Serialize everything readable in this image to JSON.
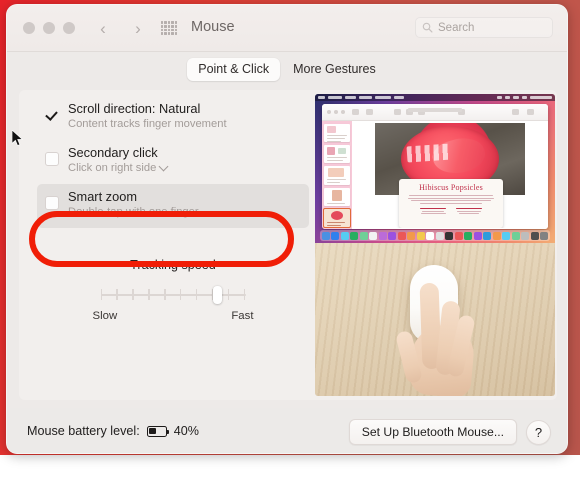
{
  "window": {
    "title": "Mouse",
    "traffic_lights": [
      "close-button",
      "minimize-button",
      "zoom-button"
    ],
    "nav_back": "‹",
    "nav_forward": "›",
    "grid_icon": "all-preferences-grid-icon"
  },
  "search": {
    "placeholder": "Search",
    "value": "",
    "icon": "search-icon"
  },
  "tabs": [
    {
      "label": "Point & Click",
      "selected": true
    },
    {
      "label": "More Gestures",
      "selected": false
    }
  ],
  "options": [
    {
      "title": "Scroll direction: Natural",
      "subtitle": "Content tracks finger movement",
      "checked": true,
      "has_dropdown": false,
      "highlighted": false
    },
    {
      "title": "Secondary click",
      "subtitle": "Click on right side",
      "checked": false,
      "has_dropdown": true,
      "highlighted": false
    },
    {
      "title": "Smart zoom",
      "subtitle": "Double-tap with one finger",
      "checked": false,
      "has_dropdown": false,
      "highlighted": true
    }
  ],
  "slider": {
    "label": "Tracking speed",
    "min_label": "Slow",
    "max_label": "Fast",
    "tick_count": 10,
    "value_percent": 81
  },
  "preview": {
    "desktop": {
      "document_title": "Hibiscus Popsicles"
    },
    "photo_alt": "hand-on-magic-mouse"
  },
  "annotation": {
    "shape": "oval",
    "color": "#f01e07",
    "targets": "Secondary click"
  },
  "status": {
    "battery_label": "Mouse battery level:",
    "battery_percent": "40%",
    "battery_fill_percent": 40
  },
  "buttons": {
    "setup": "Set Up Bluetooth Mouse...",
    "help": "?"
  }
}
